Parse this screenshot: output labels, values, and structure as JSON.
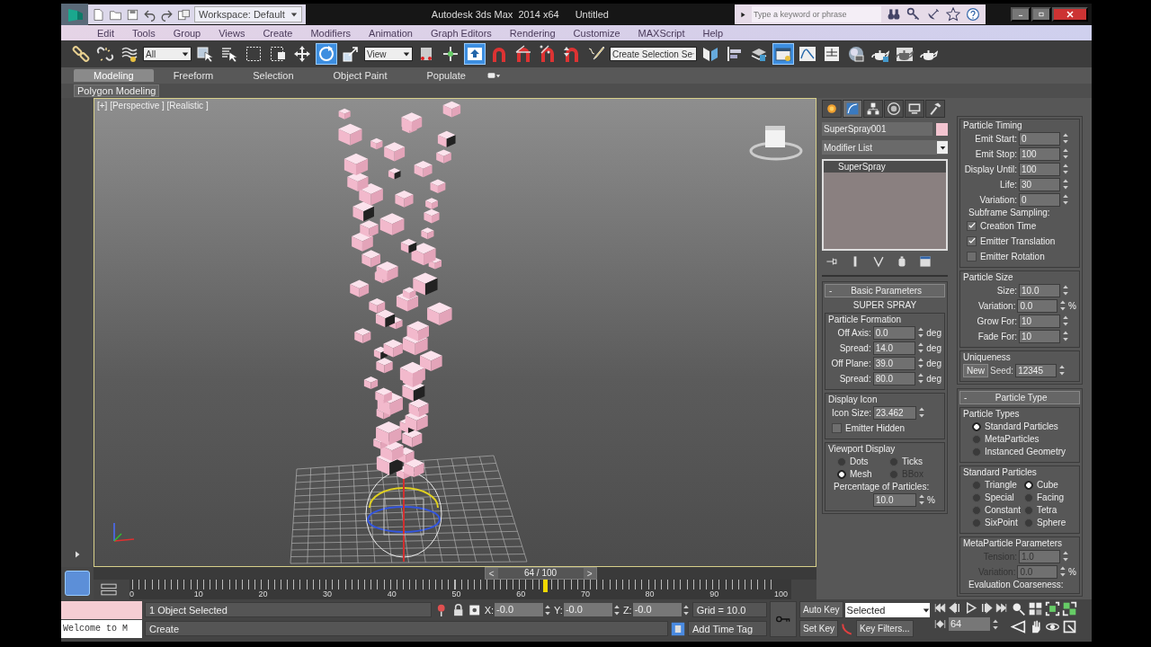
{
  "title_bar": {
    "workspace": "Workspace: Default",
    "app_title": "Autodesk 3ds Max  2014 x64",
    "document": "Untitled",
    "search": {
      "placeholder": "Type a keyword or phrase"
    }
  },
  "menu_bar": [
    "Edit",
    "Tools",
    "Group",
    "Views",
    "Create",
    "Modifiers",
    "Animation",
    "Graph Editors",
    "Rendering",
    "Customize",
    "MAXScript",
    "Help"
  ],
  "main_toolbar": [
    {
      "kind": "link",
      "on": false
    },
    {
      "kind": "unlink",
      "on": false
    },
    {
      "kind": "bind",
      "on": false
    },
    {
      "kind": "dropdown",
      "value": "All"
    },
    {
      "kind": "select",
      "on": false
    },
    {
      "kind": "select_name",
      "on": false
    },
    {
      "kind": "region",
      "on": false
    },
    {
      "kind": "crossing",
      "on": false
    },
    {
      "kind": "move",
      "on": false
    },
    {
      "kind": "rotate",
      "on": true
    },
    {
      "kind": "scale",
      "on": false
    },
    {
      "kind": "dropdown",
      "value": "View"
    },
    {
      "kind": "pivot",
      "on": false
    },
    {
      "kind": "manipulate",
      "on": false
    },
    {
      "kind": "override",
      "on": true
    },
    {
      "kind": "snap",
      "on": false
    },
    {
      "kind": "angle_snap",
      "on": false
    },
    {
      "kind": "percent_snap",
      "on": false
    },
    {
      "kind": "spinner_snap",
      "on": false
    },
    {
      "kind": "named_edit",
      "on": false
    },
    {
      "kind": "dropdown",
      "value": "Create Selection Se"
    },
    {
      "kind": "mirror",
      "on": false
    },
    {
      "kind": "align",
      "on": false
    },
    {
      "kind": "layers",
      "on": false
    },
    {
      "kind": "explorer",
      "on": true
    },
    {
      "kind": "curve",
      "on": false
    },
    {
      "kind": "schematic",
      "on": false
    },
    {
      "kind": "material",
      "on": false
    },
    {
      "kind": "render_setup",
      "on": false
    },
    {
      "kind": "frame_window",
      "on": false
    },
    {
      "kind": "render",
      "on": false
    }
  ],
  "ribbon": {
    "tabs": [
      {
        "label": "Modeling",
        "selected": true
      },
      {
        "label": "Freeform",
        "selected": false
      },
      {
        "label": "Selection",
        "selected": false
      },
      {
        "label": "Object Paint",
        "selected": false
      },
      {
        "label": "Populate",
        "selected": false
      }
    ],
    "panel": "Polygon Modeling"
  },
  "viewport": {
    "label": "[+] [Perspective ] [Realistic ]"
  },
  "command_panel": {
    "tabs": [
      {
        "kind": "create",
        "selected": false
      },
      {
        "kind": "modify",
        "selected": true
      },
      {
        "kind": "hierarchy",
        "selected": false
      },
      {
        "kind": "motion",
        "selected": false
      },
      {
        "kind": "display",
        "selected": false
      },
      {
        "kind": "utilities",
        "selected": false
      }
    ],
    "object_name": "SuperSpray001",
    "modifier_list": "Modifier List",
    "stack": [
      {
        "label": "SuperSpray",
        "selected": true
      }
    ],
    "columns": [
      [
        {
          "toggle": "-",
          "title": "Basic Parameters",
          "subtitle": "SUPER SPRAY",
          "groups": [
            {
              "title": "Particle Formation",
              "rows": [
                {
                  "kind": "spinner",
                  "label": "Off Axis:",
                  "value": "0.0",
                  "unit": "deg"
                },
                {
                  "kind": "spinner",
                  "label": "Spread:",
                  "value": "14.0",
                  "unit": "deg"
                },
                {
                  "kind": "spinner",
                  "label": "Off Plane:",
                  "value": "39.0",
                  "unit": "deg"
                },
                {
                  "kind": "spinner",
                  "label": "Spread:",
                  "value": "80.0",
                  "unit": "deg"
                }
              ]
            },
            {
              "title": "Display Icon",
              "rows": [
                {
                  "kind": "spinner",
                  "label": "Icon Size:",
                  "value": "23.462"
                },
                {
                  "kind": "check",
                  "label": "Emitter Hidden",
                  "checked": false
                }
              ]
            },
            {
              "title": "Viewport Display",
              "rows": [
                {
                  "kind": "radio_grid",
                  "items": [
                    {
                      "label": "Dots",
                      "selected": false,
                      "disabled": false
                    },
                    {
                      "label": "Ticks",
                      "selected": false,
                      "disabled": false
                    },
                    {
                      "label": "Mesh",
                      "selected": true,
                      "disabled": false
                    },
                    {
                      "label": "BBox",
                      "selected": false,
                      "disabled": true
                    }
                  ]
                },
                {
                  "kind": "note",
                  "text": "Percentage of Particles:"
                },
                {
                  "kind": "spinner",
                  "value": "10.0",
                  "unit": "%"
                }
              ]
            }
          ]
        }
      ],
      [
        {
          "groups": [
            {
              "title": "Particle Timing",
              "rows": [
                {
                  "kind": "spinner",
                  "label": "Emit Start:",
                  "value": "0"
                },
                {
                  "kind": "spinner",
                  "label": "Emit Stop:",
                  "value": "100"
                },
                {
                  "kind": "spinner",
                  "label": "Display Until:",
                  "value": "100"
                },
                {
                  "kind": "spinner",
                  "label": "Life:",
                  "value": "30"
                },
                {
                  "kind": "spinner",
                  "label": "Variation:",
                  "value": "0"
                },
                {
                  "kind": "note",
                  "text": "Subframe Sampling:"
                },
                {
                  "kind": "check",
                  "label": "Creation Time",
                  "checked": true
                },
                {
                  "kind": "check",
                  "label": "Emitter Translation",
                  "checked": true
                },
                {
                  "kind": "check",
                  "label": "Emitter Rotation",
                  "checked": false
                }
              ]
            },
            {
              "title": "Particle Size",
              "rows": [
                {
                  "kind": "spinner",
                  "label": "Size:",
                  "value": "10.0"
                },
                {
                  "kind": "spinner",
                  "label": "Variation:",
                  "value": "0.0",
                  "unit": "%"
                },
                {
                  "kind": "spinner",
                  "label": "Grow For:",
                  "value": "10"
                },
                {
                  "kind": "spinner",
                  "label": "Fade For:",
                  "value": "10"
                }
              ]
            },
            {
              "title": "Uniqueness",
              "rows": [
                {
                  "kind": "seed",
                  "button": "New",
                  "label": "Seed:",
                  "value": "12345"
                }
              ]
            }
          ]
        },
        {
          "toggle": "-",
          "title": "Particle Type",
          "groups": [
            {
              "title": "Particle Types",
              "rows": [
                {
                  "kind": "radio_list",
                  "items": [
                    {
                      "label": "Standard Particles",
                      "selected": true
                    },
                    {
                      "label": "MetaParticles",
                      "selected": false
                    },
                    {
                      "label": "Instanced Geometry",
                      "selected": false
                    }
                  ]
                }
              ]
            },
            {
              "title": "Standard Particles",
              "rows": [
                {
                  "kind": "radio_grid",
                  "items": [
                    {
                      "label": "Triangle",
                      "selected": false
                    },
                    {
                      "label": "Cube",
                      "selected": true
                    },
                    {
                      "label": "Special",
                      "selected": false
                    },
                    {
                      "label": "Facing",
                      "selected": false
                    },
                    {
                      "label": "Constant",
                      "selected": false
                    },
                    {
                      "label": "Tetra",
                      "selected": false
                    },
                    {
                      "label": "SixPoint",
                      "selected": false
                    },
                    {
                      "label": "Sphere",
                      "selected": false
                    }
                  ]
                }
              ]
            },
            {
              "title": "MetaParticle Parameters",
              "rows": [
                {
                  "kind": "spinner",
                  "label": "Tension:",
                  "value": "1.0",
                  "disabled": true
                },
                {
                  "kind": "spinner",
                  "label": "Variation:",
                  "value": "0.0",
                  "unit": "%",
                  "disabled": true
                },
                {
                  "kind": "note",
                  "text": "Evaluation Coarseness:",
                  "disabled": false
                }
              ]
            }
          ]
        }
      ]
    ]
  },
  "time_slider": {
    "prev": "<",
    "frame": "64 / 100",
    "next": ">",
    "level": 0.64,
    "ticks": [
      "0",
      "10",
      "20",
      "30",
      "40",
      "50",
      "60",
      "70",
      "80",
      "90",
      "100"
    ]
  },
  "status_bar": {
    "listener": "Welcome to M",
    "selection": "1 Object Selected",
    "prompt": "Create",
    "coords": [
      {
        "axis": "X:",
        "value": "-0.0"
      },
      {
        "axis": "Y:",
        "value": "-0.0"
      },
      {
        "axis": "Z:",
        "value": "-0.0"
      }
    ],
    "grid": "Grid = 10.0",
    "time_tag": "Add Time Tag",
    "auto_key": "Auto Key",
    "key_mode": "Selected",
    "set_key": "Set Key",
    "key_filters": "Key Filters...",
    "current_frame": "64"
  }
}
